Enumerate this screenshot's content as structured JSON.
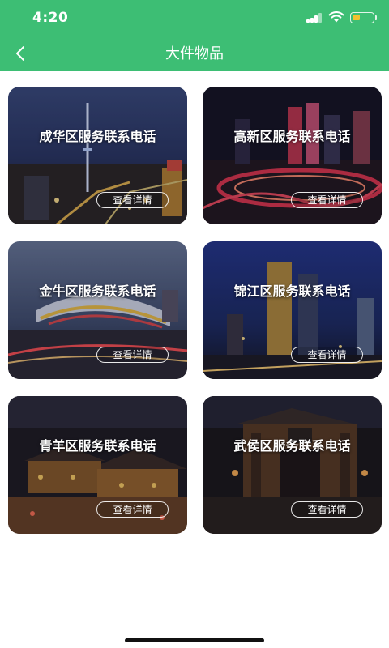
{
  "status_bar": {
    "time": "4:20"
  },
  "nav": {
    "title": "大件物品"
  },
  "districts": [
    {
      "title": "成华区服务联系电话",
      "button": "查看详情"
    },
    {
      "title": "高新区服务联系电话",
      "button": "查看详情"
    },
    {
      "title": "金牛区服务联系电话",
      "button": "查看详情"
    },
    {
      "title": "锦江区服务联系电话",
      "button": "查看详情"
    },
    {
      "title": "青羊区服务联系电话",
      "button": "查看详情"
    },
    {
      "title": "武侯区服务联系电话",
      "button": "查看详情"
    }
  ],
  "colors": {
    "header": "#3dbe74",
    "battery": "#f2c230"
  },
  "icons": [
    "back-arrow-icon",
    "signal-icon",
    "wifi-icon",
    "battery-icon"
  ]
}
